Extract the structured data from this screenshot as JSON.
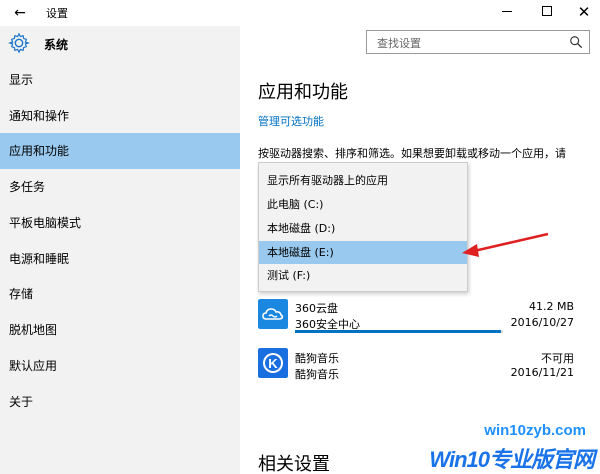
{
  "window": {
    "title": "设置"
  },
  "sidebar": {
    "header_label": "系统",
    "items": [
      {
        "label": "显示"
      },
      {
        "label": "通知和操作"
      },
      {
        "label": "应用和功能",
        "selected": true
      },
      {
        "label": "多任务"
      },
      {
        "label": "平板电脑模式"
      },
      {
        "label": "电源和睡眠"
      },
      {
        "label": "存储"
      },
      {
        "label": "脱机地图"
      },
      {
        "label": "默认应用"
      },
      {
        "label": "关于"
      }
    ]
  },
  "search": {
    "placeholder": "查找设置"
  },
  "main": {
    "title": "应用和功能",
    "manage_link": "管理可选功能",
    "description": "按驱动器搜索、排序和筛选。如果想要卸载或移动一个应用，请"
  },
  "dropdown": {
    "options": [
      {
        "label": "显示所有驱动器上的应用"
      },
      {
        "label": "此电脑 (C:)"
      },
      {
        "label": "本地磁盘 (D:)"
      },
      {
        "label": "本地磁盘 (E:)",
        "selected": true
      },
      {
        "label": "测试 (F:)"
      }
    ]
  },
  "apps": [
    {
      "name": "360云盘",
      "publisher": "360安全中心",
      "size": "41.2 MB",
      "date": "2016/10/27",
      "progress": 0.99
    },
    {
      "name": "酷狗音乐",
      "publisher": "酷狗音乐",
      "size": "不可用",
      "date": "2016/11/21"
    }
  ],
  "related": {
    "title": "相关设置"
  },
  "watermark": {
    "url": "win10zyb.com",
    "brand": "Win10专业版官网"
  },
  "colors": {
    "accent": "#0073c6",
    "selection": "#99c9ee",
    "sidebar_bg": "#f2f2f2",
    "arrow": "#e02020",
    "cloud_icon": "#1a88e0",
    "kugou_icon": "#1a6fe0"
  }
}
